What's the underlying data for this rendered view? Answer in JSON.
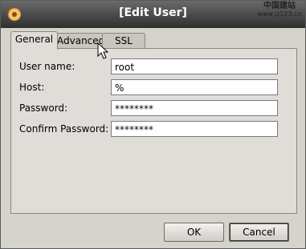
{
  "window": {
    "title": "[Edit User]"
  },
  "watermark": {
    "line1": "中国建站",
    "line2": "www.jz123.cn"
  },
  "tabs": [
    {
      "label": "General"
    },
    {
      "label": "Advanced"
    },
    {
      "label": "SSL"
    }
  ],
  "form": {
    "username_label": "User name:",
    "username_value": "root",
    "host_label": "Host:",
    "host_value": "%",
    "password_label": "Password:",
    "password_value": "********",
    "confirm_label": "Confirm Password:",
    "confirm_value": "********"
  },
  "buttons": {
    "ok": "OK",
    "cancel": "Cancel"
  },
  "icons": {
    "title": "app-icon",
    "cursor": "mouse-pointer-icon"
  },
  "colors": {
    "titlebar": "#3c3c3c",
    "dialog": "#d6d2cc",
    "panel": "#e0ddd8"
  }
}
